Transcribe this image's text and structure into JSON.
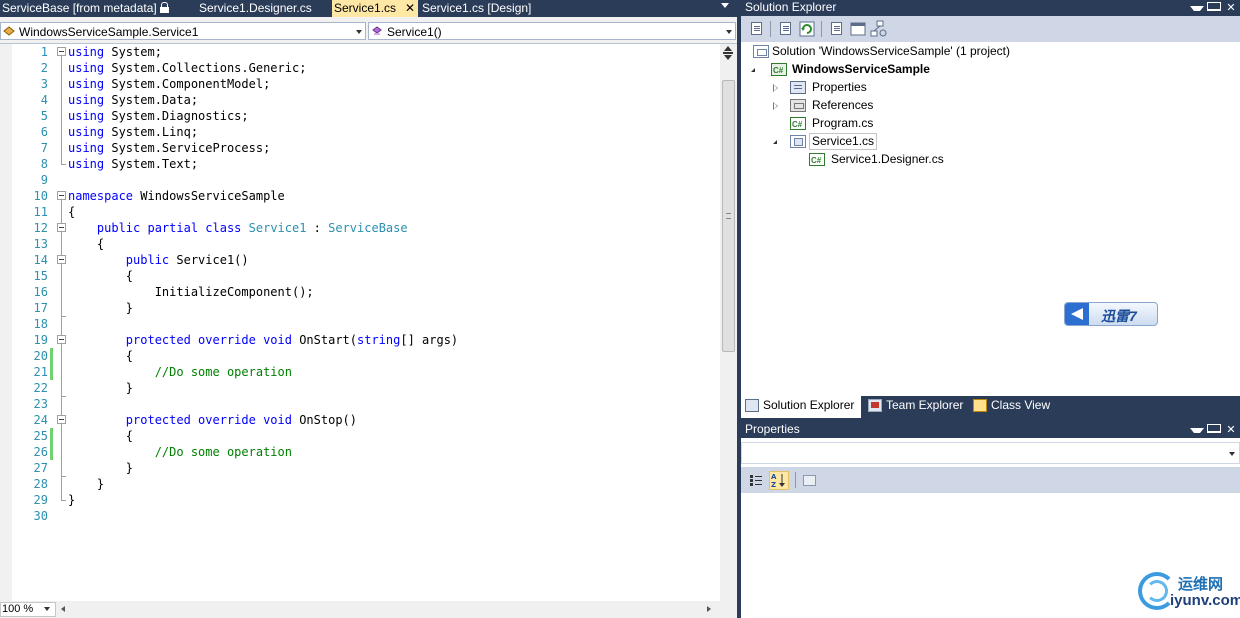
{
  "editor": {
    "tabs": [
      {
        "label": "ServiceBase [from metadata]",
        "active": false
      },
      {
        "label": "Service1.Designer.cs",
        "active": false
      },
      {
        "label": "Service1.cs",
        "active": true,
        "close": "✕"
      },
      {
        "label": "Service1.cs [Design]",
        "active": false
      }
    ],
    "nav": {
      "type_combo": "WindowsServiceSample.Service1",
      "member_combo": "Service1()"
    },
    "zoom": "100 %",
    "line_numbers": [
      "1",
      "2",
      "3",
      "4",
      "5",
      "6",
      "7",
      "8",
      "9",
      "10",
      "11",
      "12",
      "13",
      "14",
      "15",
      "16",
      "17",
      "18",
      "19",
      "20",
      "21",
      "22",
      "23",
      "24",
      "25",
      "26",
      "27",
      "28",
      "29",
      "30"
    ],
    "code": {
      "l1_kw": "using",
      "l1_rest": " System;",
      "l2_kw": "using",
      "l2_rest": " System.Collections.Generic;",
      "l3_kw": "using",
      "l3_rest": " System.ComponentModel;",
      "l4_kw": "using",
      "l4_rest": " System.Data;",
      "l5_kw": "using",
      "l5_rest": " System.Diagnostics;",
      "l6_kw": "using",
      "l6_rest": " System.Linq;",
      "l7_kw": "using",
      "l7_rest": " System.ServiceProcess;",
      "l8_kw": "using",
      "l8_rest": " System.Text;",
      "l10_kw": "namespace",
      "l10_rest": " WindowsServiceSample",
      "l11": "{",
      "l12_indent": "    ",
      "l12_kw": "public partial class",
      "l12_sp": " ",
      "l12_type": "Service1",
      "l12_colon": " : ",
      "l12_base": "ServiceBase",
      "l13": "    {",
      "l14_indent": "        ",
      "l14_kw": "public",
      "l14_rest": " Service1()",
      "l15": "        {",
      "l16": "            InitializeComponent();",
      "l17": "        }",
      "l19_indent": "        ",
      "l19_kw": "protected override void",
      "l19_name": " OnStart(",
      "l19_kw2": "string",
      "l19_rest": "[] args)",
      "l20": "        {",
      "l21_indent": "            ",
      "l21_cm": "//Do some operation",
      "l22": "        }",
      "l24_indent": "        ",
      "l24_kw": "protected override void",
      "l24_rest": " OnStop()",
      "l25": "        {",
      "l26_indent": "            ",
      "l26_cm": "//Do some operation",
      "l27": "        }",
      "l28": "    }",
      "l29": "}"
    }
  },
  "solution_explorer": {
    "title": "Solution Explorer",
    "items": {
      "solution": "Solution 'WindowsServiceSample' (1 project)",
      "project": "WindowsServiceSample",
      "properties": "Properties",
      "references": "References",
      "program": "Program.cs",
      "service1": "Service1.cs",
      "designer": "Service1.Designer.cs"
    },
    "bottom_tabs": [
      "Solution Explorer",
      "Team Explorer",
      "Class View"
    ]
  },
  "thunder_badge": "迅雷7",
  "properties": {
    "title": "Properties"
  },
  "watermark": {
    "cn": "运维网",
    "en": "iyunv.com"
  },
  "colors": {
    "chrome": "#2b3c59",
    "active_tab": "#ffe8a6",
    "keyword": "#0000ff",
    "type": "#2b91af",
    "comment": "#008000",
    "line_number": "#2b91af",
    "change_marker": "#6fd16f"
  }
}
